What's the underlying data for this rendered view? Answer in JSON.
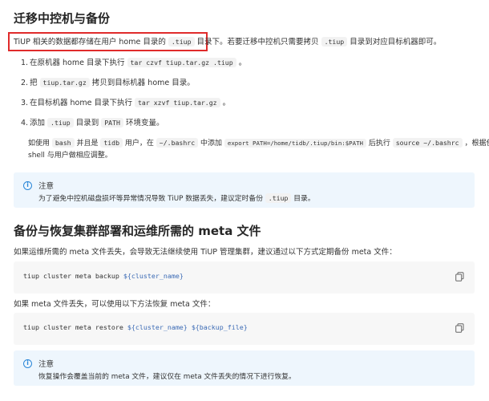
{
  "section1": {
    "heading": "迁移中控机与备份",
    "intro_highlighted": [
      "TiUP 相关的数据都存储在用户 home 目录的 ",
      ".tiup",
      " 目录下"
    ],
    "intro_rest": [
      "。若要迁移中控机只需要拷贝 ",
      ".tiup",
      " 目录到对应目标机器即可。"
    ],
    "steps": [
      {
        "num": "1.",
        "parts": [
          "在原机器 home 目录下执行 ",
          "tar czvf tiup.tar.gz .tiup",
          " 。"
        ]
      },
      {
        "num": "2.",
        "parts": [
          "把 ",
          "tiup.tar.gz",
          " 拷贝到目标机器 home 目录。"
        ]
      },
      {
        "num": "3.",
        "parts": [
          "在目标机器 home 目录下执行 ",
          "tar xzvf tiup.tar.gz",
          " 。"
        ]
      },
      {
        "num": "4.",
        "parts": [
          "添加 ",
          ".tiup",
          " 目录到 ",
          "PATH",
          " 环境变量。"
        ]
      }
    ],
    "step4_detail_line1": [
      "如使用 ",
      "bash",
      " 并且是 ",
      "tidb",
      " 用户，在 ",
      "~/.bashrc",
      " 中添加 ",
      "export PATH=/home/tidb/.tiup/bin:$PATH",
      " 后执行 ",
      "source ~/.bashrc",
      " ，根据使用的"
    ],
    "step4_detail_line2": "shell 与用户做相应调整。",
    "note": {
      "title": "注意",
      "body": [
        "为了避免中控机磁盘损坏等异常情况导致 TiUP 数据丢失，建议定时备份 ",
        ".tiup",
        " 目录。"
      ]
    }
  },
  "section2": {
    "heading": "备份与恢复集群部署和运维所需的 meta 文件",
    "para1": "如果运维所需的 meta 文件丢失，会导致无法继续使用 TiUP 管理集群，建议通过以下方式定期备份 meta 文件：",
    "code1": {
      "cmd": "tiup cluster meta backup ",
      "var": "${cluster_name}"
    },
    "para2": "如果 meta 文件丢失，可以使用以下方法恢复 meta 文件：",
    "code2": {
      "cmd": "tiup cluster meta restore ",
      "var1": "${cluster_name}",
      "sep": " ",
      "var2": "${backup_file}"
    },
    "note": {
      "title": "注意",
      "body": "恢复操作会覆盖当前的 meta 文件，建议仅在 meta 文件丢失的情况下进行恢复。"
    }
  },
  "icons": {
    "info": "info-icon",
    "copy": "copy-icon"
  },
  "colors": {
    "highlight_border": "#e02b2b",
    "note_bg": "#eef6fd",
    "info_blue": "#2b87d8",
    "code_var": "#3c6bb5"
  }
}
